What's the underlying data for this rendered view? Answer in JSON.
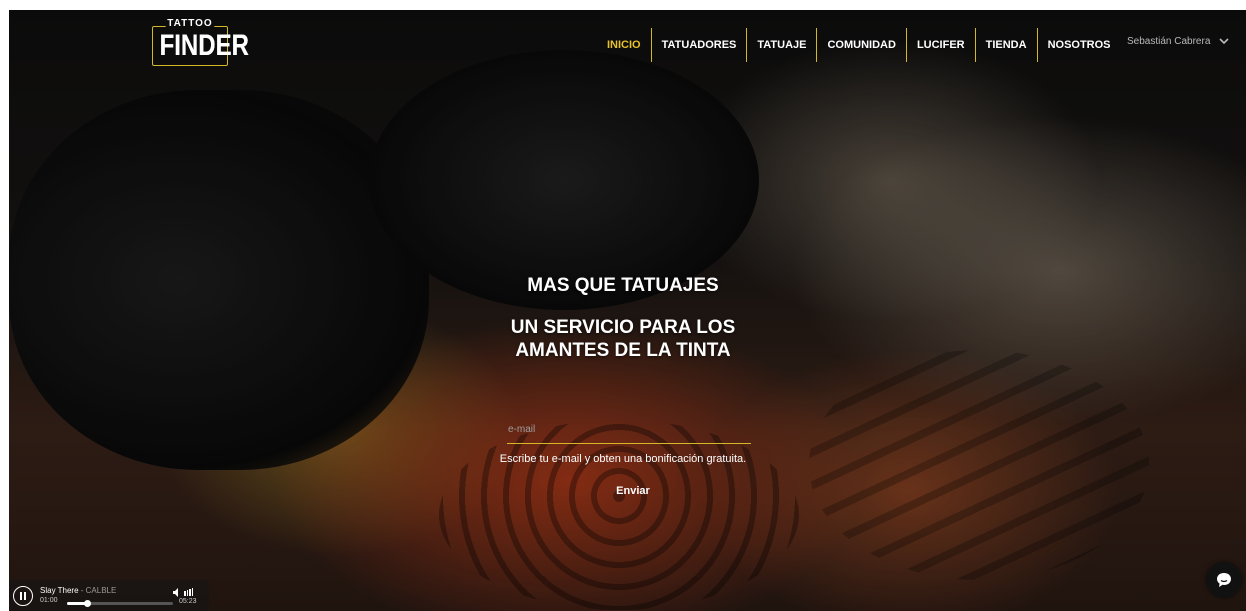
{
  "brand": {
    "small": "TATTOO",
    "big": "FINDER"
  },
  "nav": {
    "items": [
      {
        "label": "INICIO",
        "active": true
      },
      {
        "label": "TATUADORES"
      },
      {
        "label": "TATUAJE"
      },
      {
        "label": "COMUNIDAD"
      },
      {
        "label": "LUCIFER"
      },
      {
        "label": "TIENDA"
      },
      {
        "label": "NOSOTROS"
      }
    ],
    "user": "Sebastián Cabrera",
    "user_icon": "chevron-down-icon"
  },
  "hero": {
    "title": "MAS QUE TATUAJES",
    "subtitle_line1": "UN SERVICIO PARA LOS",
    "subtitle_line2": "AMANTES DE LA TINTA",
    "email_placeholder": "e-mail",
    "note": "Escribe tu e-mail y obten una bonificación gratuita.",
    "submit": "Enviar"
  },
  "player": {
    "track": "Slay There",
    "artist": "CALBLE",
    "separator": " - ",
    "current_time": "01:00",
    "duration": "05:23",
    "progress": 0.19,
    "state_icon": "pause-icon"
  },
  "chat": {
    "icon": "chat-bubble-icon"
  },
  "colors": {
    "accent": "#e8c22a",
    "divider": "#d4b828",
    "text": "#ffffff"
  }
}
